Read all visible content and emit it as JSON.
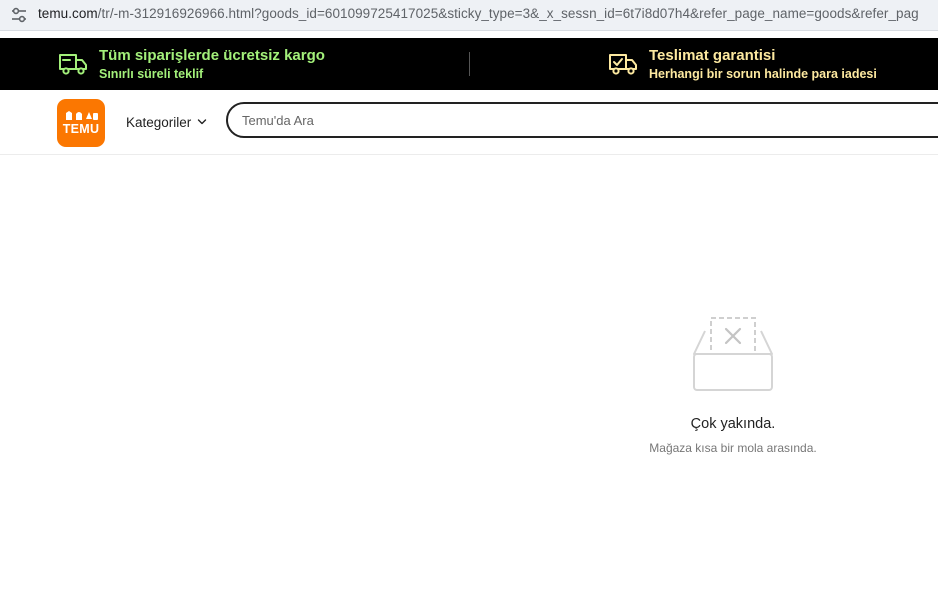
{
  "browser": {
    "url_domain": "temu.com",
    "url_rest": "/tr/-m-312916926966.html?goods_id=601099725417025&sticky_type=3&_x_sessn_id=6t7i8d07h4&refer_page_name=goods&refer_pag",
    "site_info_icon": "tune-icon"
  },
  "promo": {
    "shipping": {
      "title": "Tüm siparişlerde ücretsiz kargo",
      "subtitle": "Sınırlı süreli teklif",
      "color": "#a3f07a",
      "icon": "truck-icon"
    },
    "guarantee": {
      "title": "Teslimat garantisi",
      "subtitle": "Herhangi bir sorun halinde para iadesi",
      "color": "#fde9a0",
      "icon": "truck-check-icon"
    }
  },
  "header": {
    "logo_text": "TEMU",
    "logo_color": "#fb7701",
    "categories_label": "Kategoriler",
    "search_placeholder": "Temu'da Ara"
  },
  "empty_state": {
    "icon": "empty-box-icon",
    "title": "Çok yakında.",
    "subtitle": "Mağaza kısa bir mola arasında."
  }
}
